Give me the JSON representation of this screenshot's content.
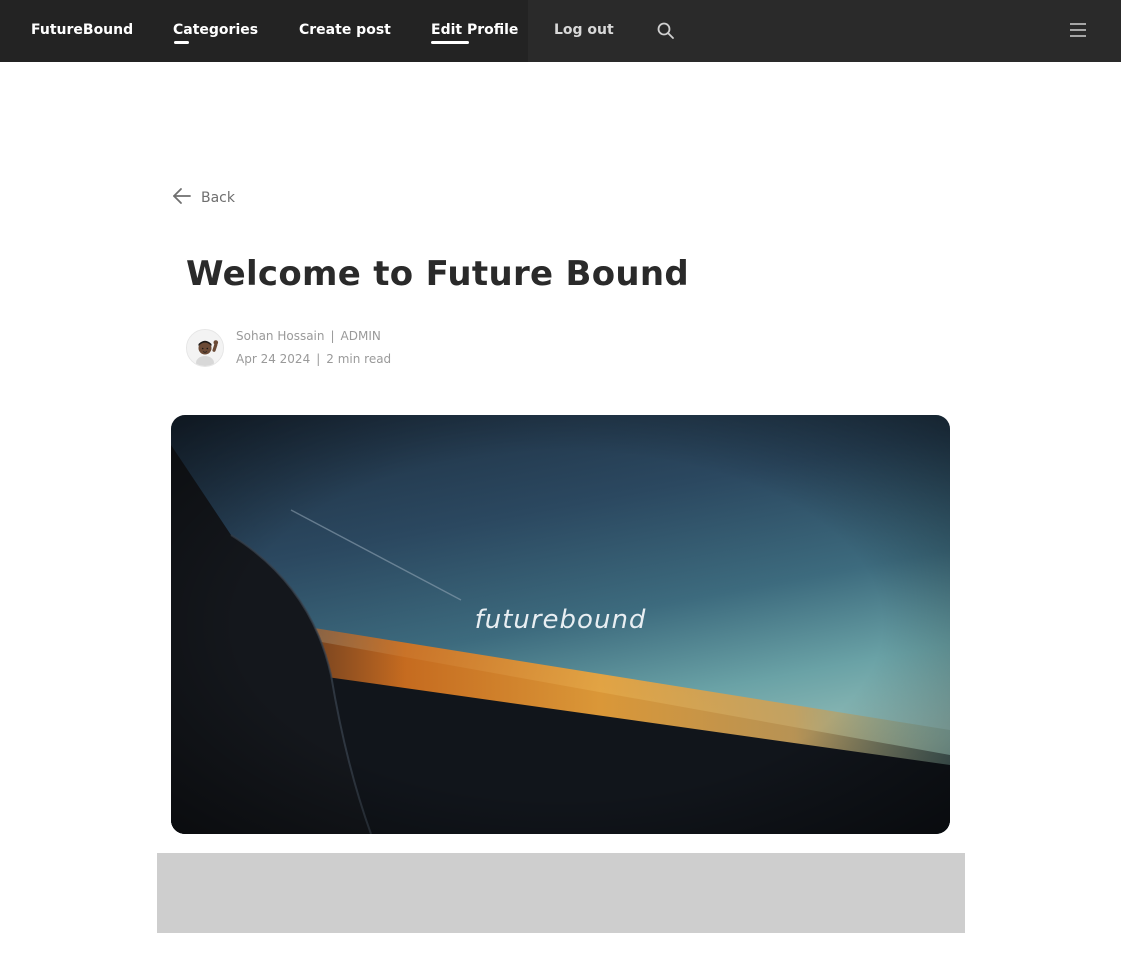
{
  "nav": {
    "brand": "FutureBound",
    "items": [
      {
        "label": "Categories"
      },
      {
        "label": "Create post"
      },
      {
        "label": "Edit Profile"
      },
      {
        "label": "Log out"
      }
    ],
    "search_icon": "search-icon",
    "menu_icon": "hamburger-menu-icon"
  },
  "back": {
    "label": "Back",
    "icon": "arrow-left-icon"
  },
  "post": {
    "title": "Welcome to Future Bound",
    "author": "Sohan Hossain",
    "role": "ADMIN",
    "date": "Apr 24 2024",
    "read_time": "2 min read",
    "hero_text": "futurebound"
  }
}
